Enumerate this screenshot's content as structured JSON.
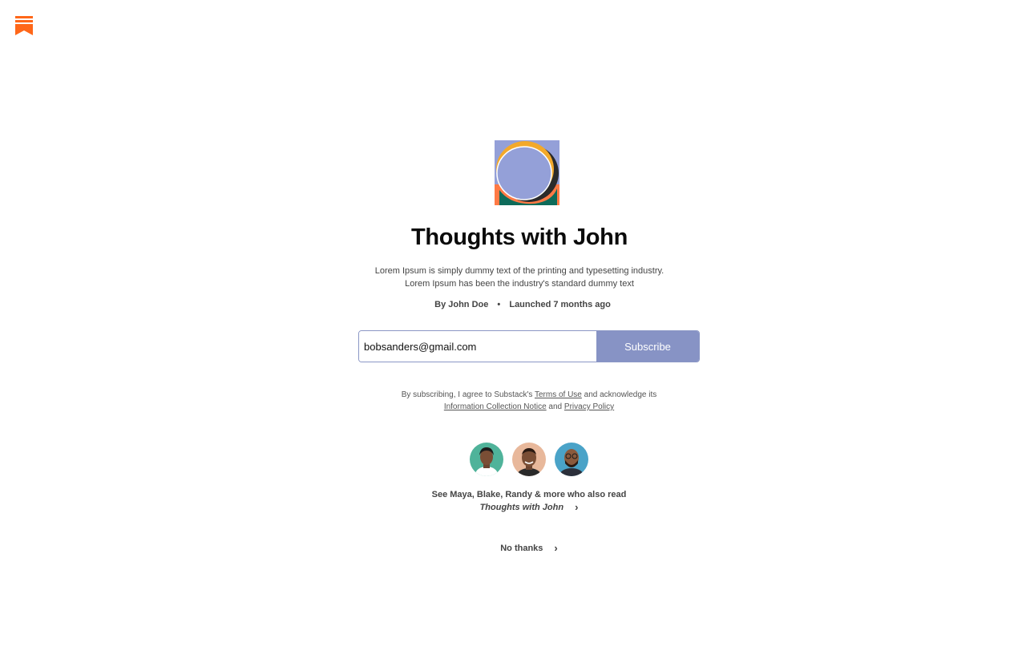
{
  "colors": {
    "brand": "#ff6719",
    "accent": "#8793c5"
  },
  "publication": {
    "title": "Thoughts with John",
    "description": "Lorem Ipsum is simply dummy text of the printing and  typesetting industry. Lorem Ipsum has been the industry's standard dummy text",
    "author_label": "By John Doe",
    "launched_label": "Launched 7 months ago"
  },
  "subscribe": {
    "email_value": "bobsanders@gmail.com",
    "button_label": "Subscribe"
  },
  "terms": {
    "prefix": "By subscribing, I agree to Substack's ",
    "terms_link": "Terms of Use",
    "middle": " and acknowledge its",
    "notice_link": "Information Collection Notice",
    "and": " and ",
    "privacy_link": "Privacy Policy"
  },
  "readers": {
    "line1": "See Maya, Blake, Randy & more who also read",
    "line2": "Thoughts with John"
  },
  "no_thanks": {
    "label": "No thanks"
  }
}
